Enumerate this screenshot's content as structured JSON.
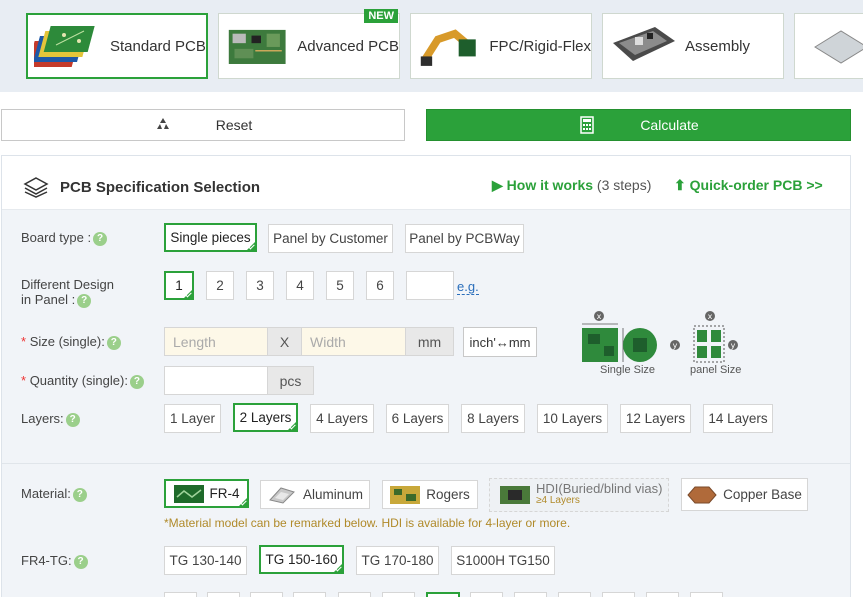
{
  "product_tabs": [
    {
      "label": "Standard PCB",
      "active": true
    },
    {
      "label": "Advanced PCB",
      "badge": "NEW"
    },
    {
      "label": "FPC/Rigid-Flex"
    },
    {
      "label": "Assembly"
    }
  ],
  "actions": {
    "reset": "Reset",
    "calculate": "Calculate"
  },
  "panel": {
    "title": "PCB Specification Selection",
    "how_it_works": "How it works",
    "how_steps": "(3 steps)",
    "quick_order": "Quick-order PCB >>"
  },
  "board_type": {
    "label": "Board type :",
    "options": [
      "Single pieces",
      "Panel by Customer",
      "Panel by PCBWay"
    ],
    "selected": "Single pieces"
  },
  "different_design": {
    "label_line1": "Different Design",
    "label_line2": "in Panel :",
    "options": [
      "1",
      "2",
      "3",
      "4",
      "5",
      "6"
    ],
    "selected": "1",
    "eg_link": "e.g."
  },
  "size": {
    "label": "Size (single):",
    "required": "*",
    "length_placeholder": "Length",
    "x_sep": "X",
    "width_placeholder": "Width",
    "unit": "mm",
    "convert_button": "inch'↔mm",
    "caption_single": "Single Size",
    "caption_panel": "panel Size"
  },
  "quantity": {
    "label": "Quantity (single):",
    "required": "*",
    "unit": "pcs"
  },
  "layers": {
    "label": "Layers:",
    "options": [
      "1 Layer",
      "2 Layers",
      "4 Layers",
      "6 Layers",
      "8 Layers",
      "10 Layers",
      "12 Layers",
      "14 Layers"
    ],
    "selected": "2 Layers"
  },
  "material": {
    "label": "Material:",
    "options": [
      "FR-4",
      "Aluminum",
      "Rogers",
      "HDI(Buried/blind vias)",
      "Copper Base"
    ],
    "hdi_sub": "≥4 Layers",
    "selected": "FR-4",
    "note": "*Material model can be remarked below. HDI is available for 4-layer or more."
  },
  "fr4_tg": {
    "label": "FR4-TG:",
    "options": [
      "TG 130-140",
      "TG 150-160",
      "TG 170-180",
      "S1000H TG150"
    ],
    "selected": "TG 150-160"
  },
  "colors": {
    "accent": "#2ba13a",
    "note": "#b08a2a",
    "link": "#2a6ebb"
  }
}
